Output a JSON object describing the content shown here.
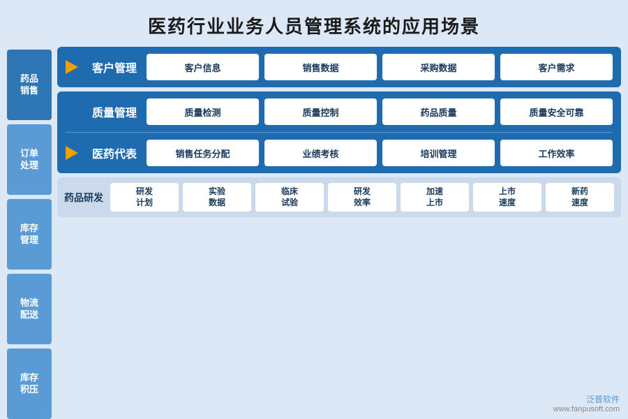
{
  "title": "医药行业业务人员管理系统的应用场景",
  "sidebar": {
    "items": [
      {
        "id": "yaopin-xiaoshou",
        "label": "药品\n销售",
        "active": true
      },
      {
        "id": "dingdan-chuli",
        "label": "订单\n处理",
        "active": false
      },
      {
        "id": "kucun-guanli",
        "label": "库存\n管理",
        "active": false
      },
      {
        "id": "wuliu-peisong",
        "label": "物流\n配送",
        "active": false
      },
      {
        "id": "kucun-jiya",
        "label": "库存\n积压",
        "active": false
      }
    ]
  },
  "sections": [
    {
      "id": "kehu-guanli",
      "label": "客户管理",
      "has_arrow": true,
      "cards": [
        "客户信息",
        "销售数据",
        "采购数据",
        "客户需求"
      ]
    },
    {
      "id": "zhiliang-guanli",
      "label": "质量管理",
      "has_arrow": false,
      "cards": [
        "质量检测",
        "质量控制",
        "药品质量",
        "质量安全可靠"
      ]
    },
    {
      "id": "yiyao-daibiao",
      "label": "医药代表",
      "has_arrow": true,
      "cards": [
        "销售任务分配",
        "业绩考核",
        "培训管理",
        "工作效率"
      ]
    }
  ],
  "bottom": {
    "label": "药品研发",
    "cards": [
      "研发\n计划",
      "实验\n数据",
      "临床\n试验",
      "研发\n效率",
      "加速\n上市",
      "上市\n速度",
      "新药\n速度"
    ]
  },
  "watermark": {
    "line1": "www.fanpusoft.com",
    "line2": "泛普软件"
  }
}
